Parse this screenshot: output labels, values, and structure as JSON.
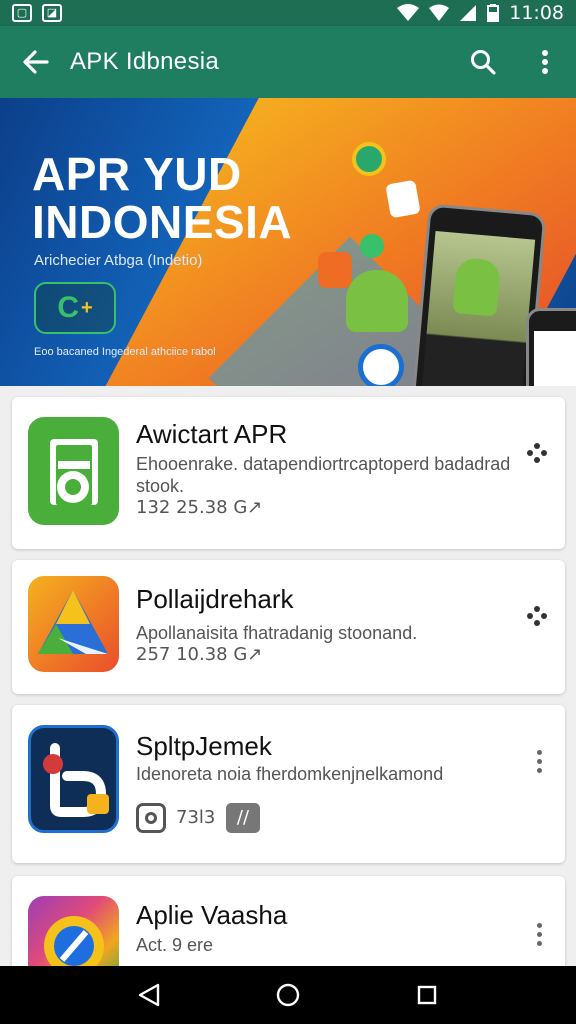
{
  "status_bar": {
    "time": "11:08",
    "left_icons": [
      "image-icon",
      "gallery-icon"
    ],
    "right_icons": [
      "wifi-icon",
      "signal-icon",
      "signal-icon",
      "battery-icon"
    ]
  },
  "app_bar": {
    "title": "APK Idbnesia",
    "back_icon": "arrow-back-icon",
    "actions": [
      "search-icon",
      "more-vert-icon"
    ],
    "color": "#1f7d60"
  },
  "banner": {
    "headline_line1": "APR YUD",
    "headline_line2": "INDONESIA",
    "subtitle": "Arichecier Atbga (Indetio)",
    "badge": "C",
    "caption": "Eoo bacaned Ingederal athciice rabol"
  },
  "apps": [
    {
      "name": "Awictart APR",
      "description": "Ehooenrake. datapendiortrcaptoperd badadrad stook.",
      "meta": "132  25.38 G↗",
      "icon": "green-a-icon",
      "menu": "share-dots-icon"
    },
    {
      "name": "Pollaijdrehark",
      "description": "Apollanaisita fhatradanig stoonand.",
      "meta": "257  10.38 G↗",
      "icon": "triangle-drive-icon",
      "menu": "share-dots-icon"
    },
    {
      "name": "SpltpJemek",
      "description": "Idenoreta noia fherdomkenjnelkamond",
      "meta": "73l3",
      "icon": "b-dark-icon",
      "menu": "more-vert-icon"
    },
    {
      "name": "Aplie Vaasha",
      "description": "Act. 9 ere",
      "meta": "",
      "icon": "chrome-like-icon",
      "menu": "more-vert-icon"
    }
  ],
  "nav_bar": [
    "back-triangle-icon",
    "home-circle-icon",
    "recents-square-icon"
  ]
}
